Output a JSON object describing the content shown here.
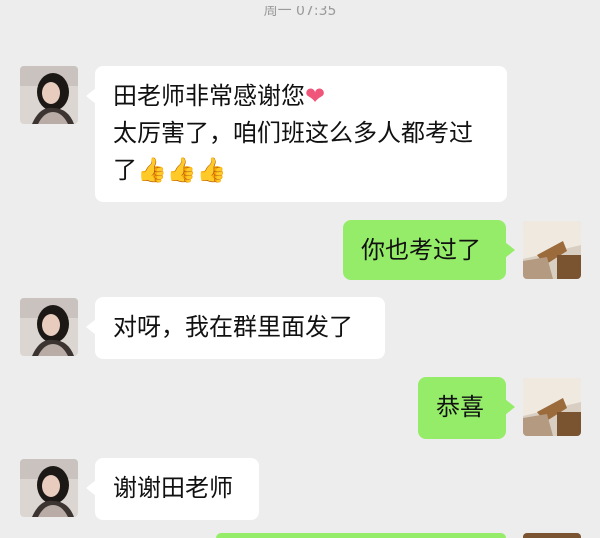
{
  "chat": {
    "timestamp": "周一 07:35",
    "messages": [
      {
        "side": "left",
        "lines": [
          "田老师非常感谢您",
          "太厉害了，咱们班这么多人都考过",
          "了"
        ],
        "emoji_after_line1": "❤",
        "emoji_after_line3": "👍👍👍"
      },
      {
        "side": "right",
        "lines": [
          "你也考过了"
        ]
      },
      {
        "side": "left",
        "lines": [
          "对呀，我在群里面发了"
        ]
      },
      {
        "side": "right",
        "lines": [
          "恭喜"
        ]
      },
      {
        "side": "left",
        "lines": [
          "谢谢田老师"
        ]
      }
    ]
  },
  "colors": {
    "background": "#ededed",
    "incoming_bubble": "#ffffff",
    "outgoing_bubble": "#95ec69"
  },
  "icons": {
    "contact_avatar": "woman-portrait-avatar",
    "self_avatar": "room-photo-avatar"
  }
}
